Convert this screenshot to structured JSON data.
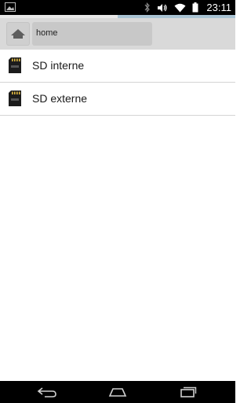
{
  "status_bar": {
    "time": "23:11",
    "icons": [
      "gallery-notification-icon",
      "bluetooth-icon",
      "volume-icon",
      "wifi-icon",
      "battery-icon"
    ]
  },
  "loading_progress": {
    "fraction_start": 0.5,
    "fraction_end": 1.0,
    "color": "#a9c3d3"
  },
  "path_bar": {
    "home_icon": "home-icon",
    "current_path": "home"
  },
  "storage_list": [
    {
      "label": "SD interne",
      "icon": "sd-card-icon"
    },
    {
      "label": "SD externe",
      "icon": "sd-card-icon"
    }
  ],
  "nav_bar": {
    "buttons": [
      "back-icon",
      "home-icon",
      "recents-icon"
    ]
  }
}
